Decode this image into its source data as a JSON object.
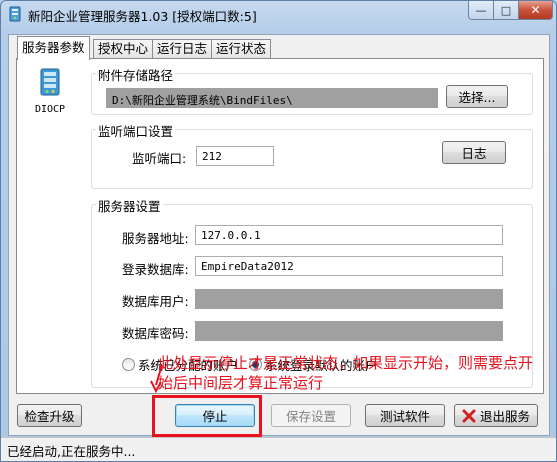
{
  "window": {
    "title": "新阳企业管理服务器1.03 [授权端口数:5]",
    "controls": {
      "minimize": "—",
      "maximize": "□",
      "close": "✕"
    }
  },
  "tabs": [
    {
      "label": "服务器参数",
      "active": true
    },
    {
      "label": "授权中心",
      "active": false
    },
    {
      "label": "运行日志",
      "active": false
    },
    {
      "label": "运行状态",
      "active": false
    }
  ],
  "logo": {
    "label": "DIOCP"
  },
  "attachment": {
    "group_title": "附件存储路径",
    "path": "D:\\新阳企业管理系统\\BindFiles\\",
    "browse_label": "选择..."
  },
  "listen": {
    "group_title": "监听端口设置",
    "port_label": "监听端口:",
    "port_value": "212",
    "log_label": "日志"
  },
  "server": {
    "group_title": "服务器设置",
    "address_label": "服务器地址:",
    "address_value": "127.0.0.1",
    "db_label": "登录数据库:",
    "db_value": "EmpireData2012",
    "db_user_label": "数据库用户:",
    "db_password_label": "数据库密码:",
    "account_options": [
      {
        "label": "系统已分配的账户",
        "selected": false
      },
      {
        "label": "系统登录默认的账户",
        "selected": true
      }
    ]
  },
  "annotation": {
    "line1": "此处显示停止才是正常状态，如果显示开始，则需要点开",
    "line2": "始后中间层才算正常运行",
    "color": "#e8121e"
  },
  "buttons": {
    "check_upgrade": "检查升级",
    "stop": "停止",
    "save_settings": "保存设置",
    "test_software": "测试软件",
    "exit_service": "退出服务"
  },
  "status": {
    "text": "已经启动,正在服务中..."
  }
}
